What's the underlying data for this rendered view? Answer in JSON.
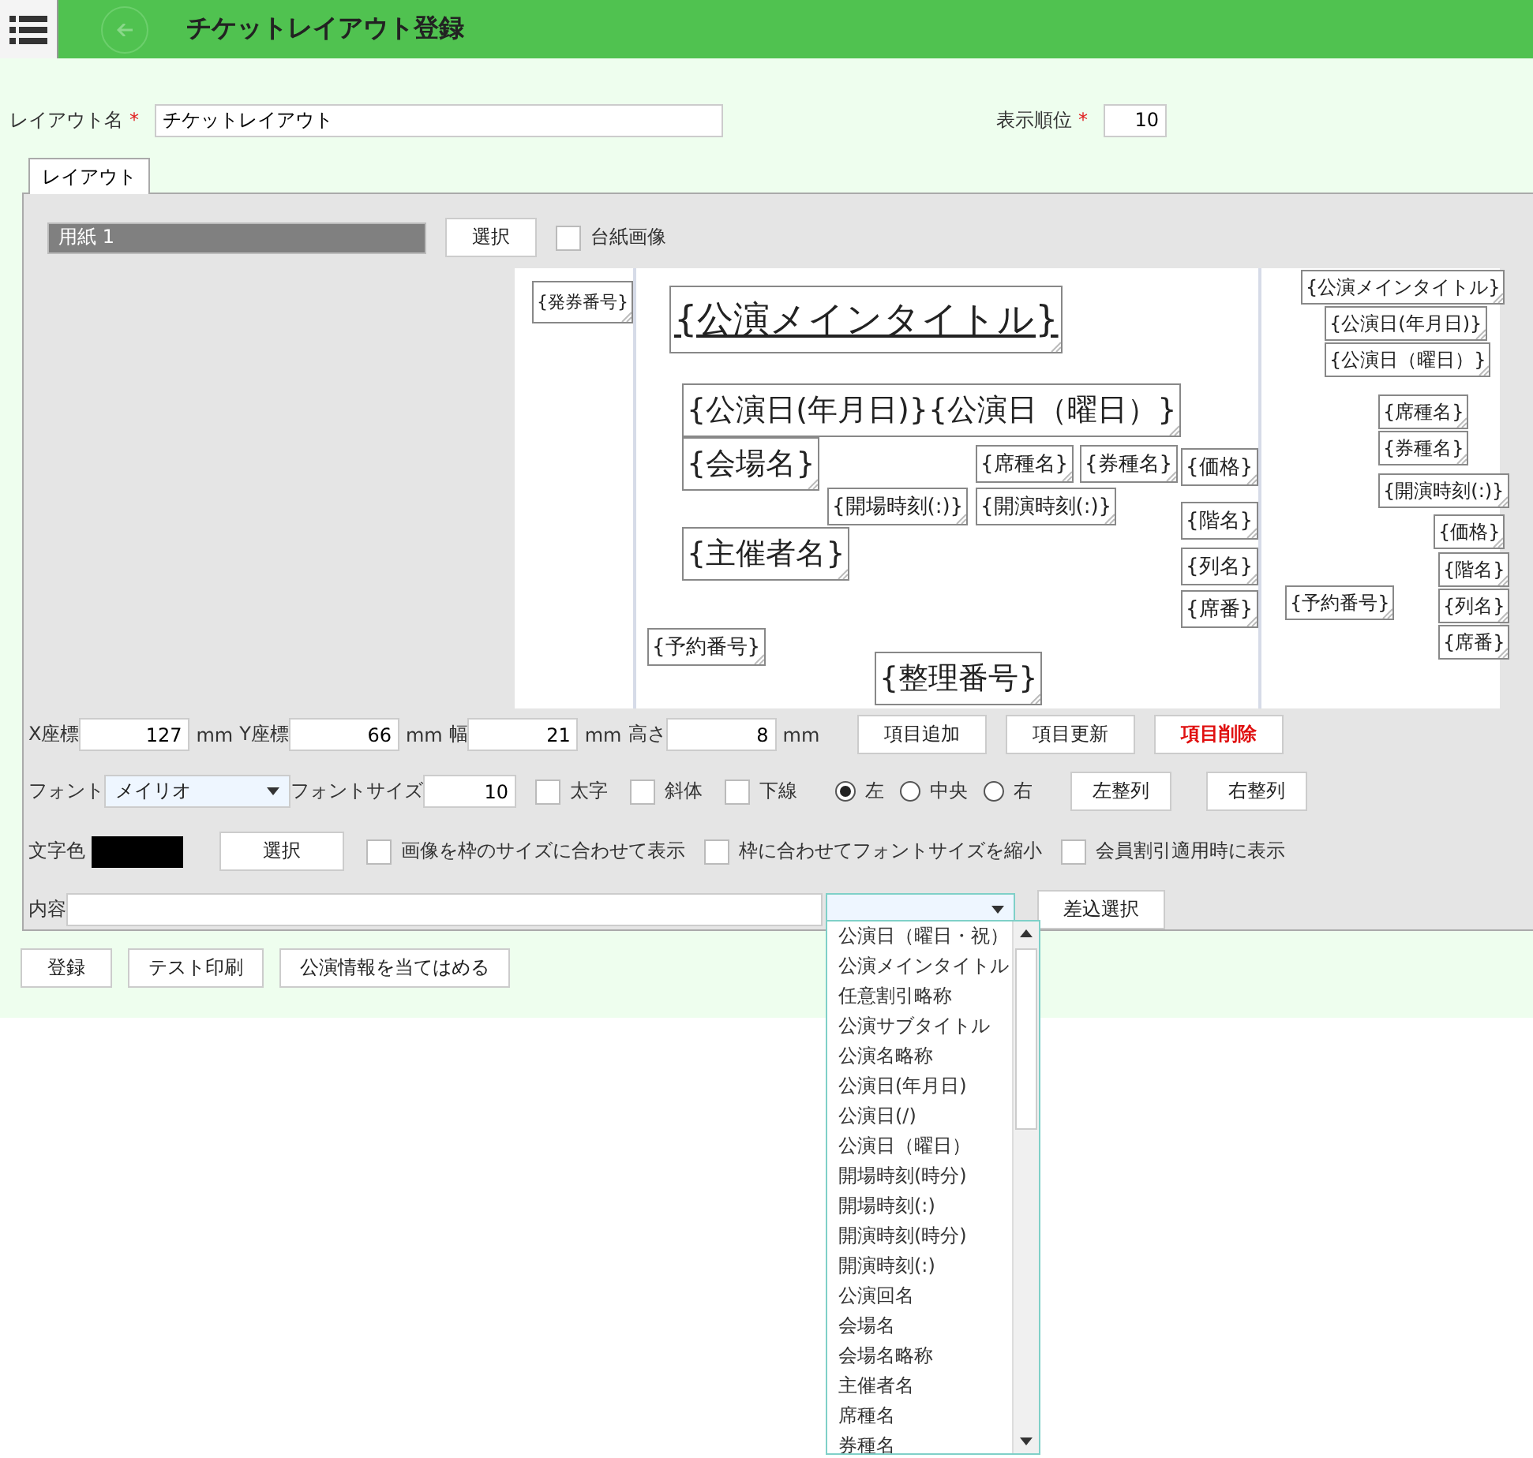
{
  "header": {
    "title": "チケットレイアウト登録"
  },
  "form": {
    "name_label": "レイアウト名",
    "name_value": "チケットレイアウト",
    "order_label": "表示順位",
    "order_value": "10",
    "required_mark": "*"
  },
  "tabs": [
    {
      "label": "レイアウト",
      "selected": true
    }
  ],
  "paper": {
    "value": "用紙 1",
    "select_button": "選択",
    "background_image": {
      "label": "台紙画像",
      "checked": false
    }
  },
  "canvas_items": [
    {
      "text": "{発券番号}",
      "kind": "small"
    },
    {
      "text": "{公演メインタイトル}",
      "kind": "title"
    },
    {
      "text": "{公演日(年月日)}{公演日（曜日）}",
      "kind": "medium"
    },
    {
      "text": "{会場名}",
      "kind": "medium"
    },
    {
      "text": "{席種名}",
      "kind": "normal"
    },
    {
      "text": "{券種名}",
      "kind": "normal"
    },
    {
      "text": "{開場時刻(:)}",
      "kind": "normal"
    },
    {
      "text": "{開演時刻(:)}",
      "kind": "normal"
    },
    {
      "text": "{主催者名}",
      "kind": "medium"
    },
    {
      "text": "{価格}",
      "kind": "normal"
    },
    {
      "text": "{階名}",
      "kind": "normal"
    },
    {
      "text": "{列名}",
      "kind": "normal"
    },
    {
      "text": "{席番}",
      "kind": "normal"
    },
    {
      "text": "{予約番号}",
      "kind": "normal"
    },
    {
      "text": "{整理番号}",
      "kind": "medium"
    },
    {
      "text": "{公演メインタイトル}",
      "kind": "compact"
    },
    {
      "text": "{公演日(年月日)}",
      "kind": "compact"
    },
    {
      "text": "{公演日（曜日）}",
      "kind": "compact"
    },
    {
      "text": "{席種名}",
      "kind": "compact"
    },
    {
      "text": "{券種名}",
      "kind": "compact"
    },
    {
      "text": "{開演時刻(:)}",
      "kind": "compact"
    },
    {
      "text": "{価格}",
      "kind": "compact"
    },
    {
      "text": "{階名}",
      "kind": "compact"
    },
    {
      "text": "{列名}",
      "kind": "compact"
    },
    {
      "text": "{席番}",
      "kind": "compact"
    },
    {
      "text": "{予約番号}",
      "kind": "compact"
    }
  ],
  "position": [
    {
      "label": "X座標",
      "value": "127",
      "unit": "mm"
    },
    {
      "label": "Y座標",
      "value": "66",
      "unit": "mm"
    },
    {
      "label": "幅",
      "value": "21",
      "unit": "mm"
    },
    {
      "label": "高さ",
      "value": "8",
      "unit": "mm"
    }
  ],
  "item_buttons": [
    {
      "label": "項目追加",
      "kind": "normal"
    },
    {
      "label": "項目更新",
      "kind": "normal"
    },
    {
      "label": "項目削除",
      "kind": "danger"
    }
  ],
  "font": {
    "label": "フォント",
    "value": "メイリオ",
    "size_label": "フォントサイズ",
    "size_value": "10"
  },
  "styles": [
    {
      "label": "太字",
      "checked": false
    },
    {
      "label": "斜体",
      "checked": false
    },
    {
      "label": "下線",
      "checked": false
    }
  ],
  "align": [
    {
      "label": "左",
      "selected": true
    },
    {
      "label": "中央",
      "selected": false
    },
    {
      "label": "右",
      "selected": false
    }
  ],
  "align_buttons": [
    "左整列",
    "右整列"
  ],
  "color": {
    "label": "文字色",
    "color": "#000000",
    "button": "選択"
  },
  "options": [
    {
      "label": "画像を枠のサイズに合わせて表示",
      "checked": false
    },
    {
      "label": "枠に合わせてフォントサイズを縮小",
      "checked": false
    },
    {
      "label": "会員割引適用時に表示",
      "checked": false
    }
  ],
  "content": {
    "label": "内容",
    "insert_button": "差込選択"
  },
  "dropdown_options": [
    "公演日（曜日・祝）",
    "公演メインタイトル",
    "任意割引略称",
    "公演サブタイトル",
    "公演名略称",
    "公演日(年月日)",
    "公演日(/)",
    "公演日（曜日）",
    "開場時刻(時分)",
    "開場時刻(:)",
    "開演時刻(時分)",
    "開演時刻(:)",
    "公演回名",
    "会場名",
    "会場名略称",
    "主催者名",
    "席種名",
    "券種名"
  ],
  "footer_buttons": [
    "登録",
    "テスト印刷",
    "公演情報を当てはめる"
  ]
}
